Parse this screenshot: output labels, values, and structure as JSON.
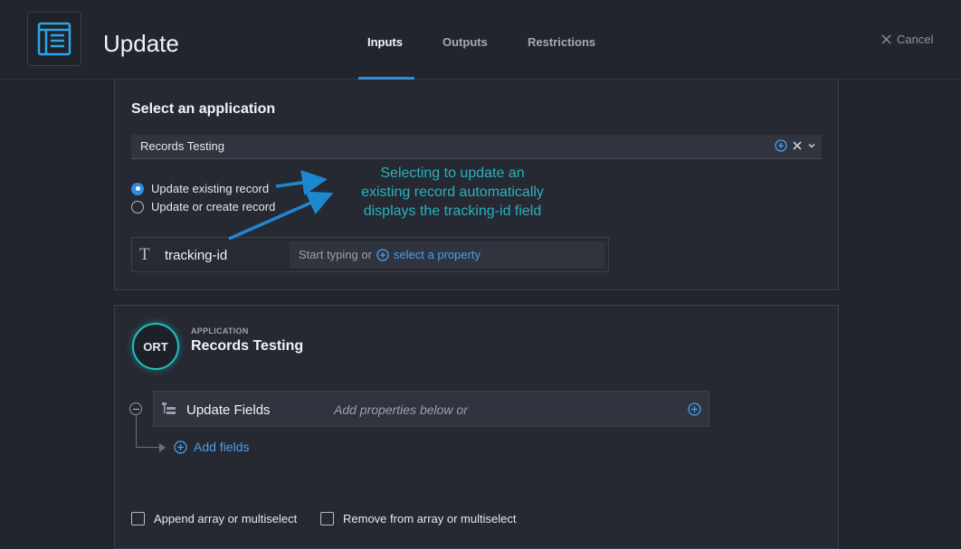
{
  "header": {
    "title": "Update",
    "tabs": [
      {
        "label": "Inputs",
        "active": true
      },
      {
        "label": "Outputs",
        "active": false
      },
      {
        "label": "Restrictions",
        "active": false
      }
    ],
    "cancel_label": "Cancel",
    "icon": "form-icon"
  },
  "select_app": {
    "heading": "Select an application",
    "selected_value": "Records Testing",
    "options": [
      {
        "label": "Update existing record",
        "selected": true
      },
      {
        "label": "Update or create record",
        "selected": false
      }
    ]
  },
  "annotation": {
    "lines": [
      "Selecting to update an",
      "existing record automatically",
      "displays the tracking-id field"
    ],
    "color": "#27b2bf"
  },
  "tracking_field": {
    "label": "tracking-id",
    "placeholder_text": "Start typing or",
    "link_text": "select a property"
  },
  "application_card": {
    "badge": "ORT",
    "caption": "APPLICATION",
    "name": "Records Testing",
    "update_fields_label": "Update Fields",
    "update_fields_hint": "Add properties below or",
    "add_fields_label": "Add fields",
    "checkboxes": [
      {
        "label": "Append array or multiselect",
        "checked": false
      },
      {
        "label": "Remove from array or multiselect",
        "checked": false
      }
    ]
  },
  "colors": {
    "accent": "#2d8ee0",
    "link": "#4b9ff0",
    "teal": "#1fbfbf",
    "background": "#22252d"
  }
}
